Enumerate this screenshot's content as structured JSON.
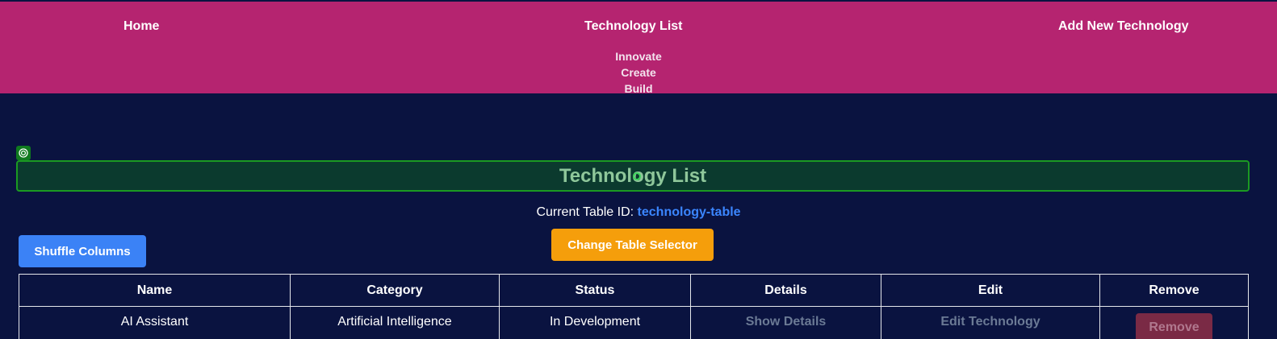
{
  "nav": {
    "home": "Home",
    "list": "Technology List",
    "add": "Add New Technology",
    "tagline": [
      "Innovate",
      "Create",
      "Build"
    ]
  },
  "heading": "Technology List",
  "table_id": {
    "label": "Current Table ID:",
    "value": "technology-table"
  },
  "buttons": {
    "shuffle": "Shuffle Columns",
    "change": "Change Table Selector"
  },
  "table": {
    "headers": [
      "Name",
      "Category",
      "Status",
      "Details",
      "Edit",
      "Remove"
    ],
    "rows": [
      {
        "name": "AI Assistant",
        "category": "Artificial Intelligence",
        "status": "In Development",
        "details": "Show Details",
        "edit": "Edit Technology",
        "remove": "Remove"
      }
    ]
  },
  "colors": {
    "header_bg": "#b52470",
    "page_bg": "#0a1340",
    "shuffle_btn": "#3b82f6",
    "change_btn": "#f59e0b",
    "heading_box": "#0b3a2e",
    "table_id": "#3b86ff"
  },
  "icons": {
    "heading_marker": "target-icon"
  }
}
